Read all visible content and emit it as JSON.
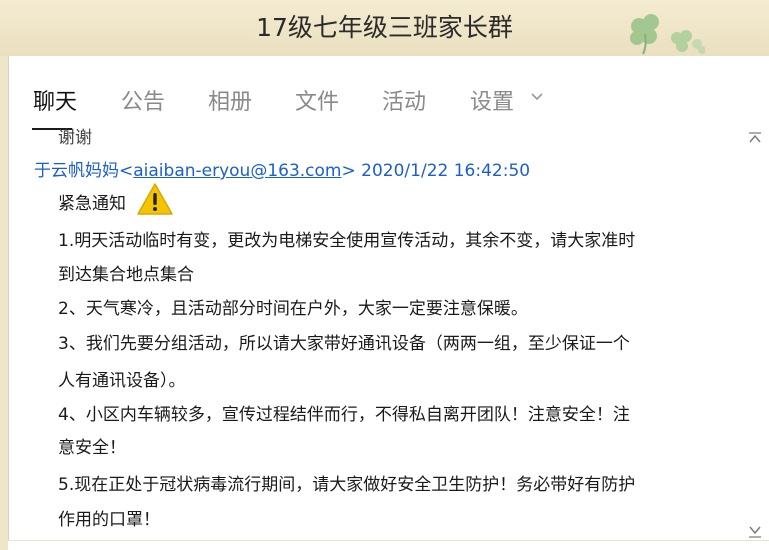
{
  "window": {
    "title": "17级七年级三班家长群"
  },
  "tabs": [
    {
      "label": "聊天",
      "active": true
    },
    {
      "label": "公告"
    },
    {
      "label": "相册"
    },
    {
      "label": "文件"
    },
    {
      "label": "活动"
    },
    {
      "label": "设置"
    }
  ],
  "previous_message": {
    "text": "谢谢"
  },
  "message": {
    "sender": "于云帆妈妈",
    "email": "aiaiban-eryou@163.com",
    "open_bracket": "<",
    "close_bracket": ">",
    "timestamp": "2020/1/22 16:42:50",
    "title": "紧急通知",
    "lines": [
      "1.明天活动临时有变，更改为电梯安全使用宣传活动，其余不变，请大家准时",
      "到达集合地点集合",
      "2、天气寒冷，且活动部分时间在户外，大家一定要注意保暖。",
      "3、我们先要分组活动，所以请大家带好通讯设备（两两一组，至少保证一个",
      "人有通讯设备）。",
      "4、小区内车辆较多，宣传过程结伴而行，不得私自离开团队！注意安全！注",
      "意安全！",
      "5.现在正处于冠状病毒流行期间，请大家做好安全卫生防护！务必带好有防护",
      "作用的口罩！"
    ]
  },
  "colors": {
    "accent": "#1a5fd1",
    "titlebar": "#efe6c9",
    "warning": "#f2c200"
  },
  "icons": [
    "clover-decoration-icon",
    "chevron-down-icon",
    "warning-icon",
    "scroll-up-icon",
    "scroll-down-icon"
  ]
}
